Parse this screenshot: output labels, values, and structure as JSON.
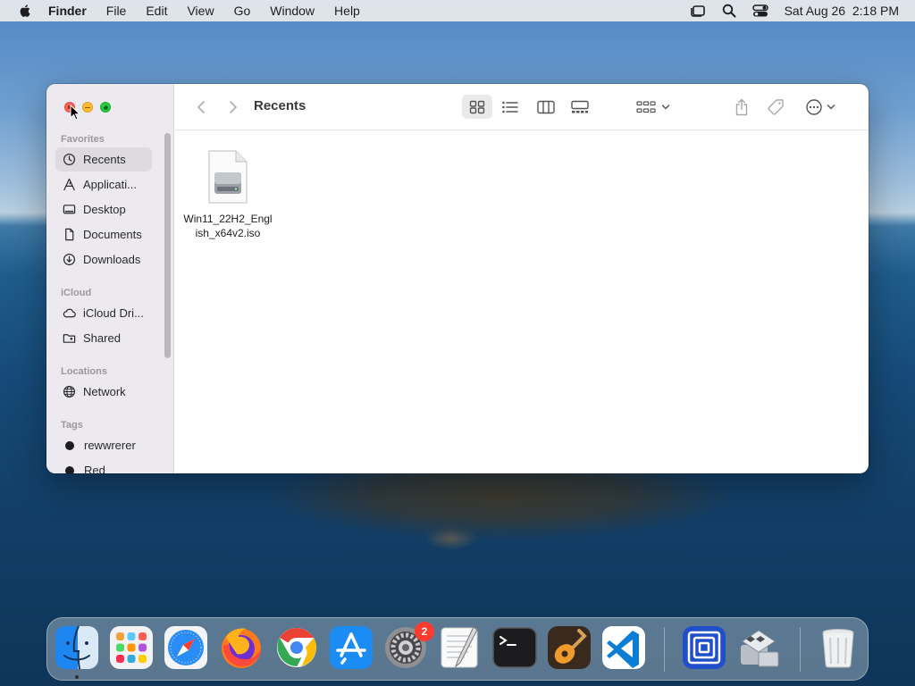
{
  "menubar": {
    "app_name": "Finder",
    "menus": [
      "File",
      "Edit",
      "View",
      "Go",
      "Window",
      "Help"
    ],
    "datetime": "Sat Aug 26  2:18 PM"
  },
  "window": {
    "title": "Recents",
    "sidebar": {
      "favorites_header": "Favorites",
      "favorites": [
        {
          "label": "Recents",
          "icon": "clock-icon",
          "selected": true
        },
        {
          "label": "Applicati...",
          "icon": "applications-icon"
        },
        {
          "label": "Desktop",
          "icon": "desktop-icon"
        },
        {
          "label": "Documents",
          "icon": "document-icon"
        },
        {
          "label": "Downloads",
          "icon": "download-icon"
        }
      ],
      "icloud_header": "iCloud",
      "icloud": [
        {
          "label": "iCloud Dri...",
          "icon": "cloud-icon"
        },
        {
          "label": "Shared",
          "icon": "shared-folder-icon"
        }
      ],
      "locations_header": "Locations",
      "locations": [
        {
          "label": "Network",
          "icon": "globe-icon"
        }
      ],
      "tags_header": "Tags",
      "tags": [
        {
          "label": "rewwrerer",
          "color": "#1d1d1f"
        },
        {
          "label": "Red",
          "color": "#1d1d1f"
        }
      ]
    },
    "files": [
      {
        "name_line1": "Win11_22H2_Engl",
        "name_line2": "ish_x64v2.iso",
        "icon": "disk-image-icon"
      }
    ]
  },
  "dock": {
    "apps": [
      "Finder",
      "Launchpad",
      "Safari",
      "Firefox",
      "Chrome",
      "App Store",
      "System Settings",
      "TextEdit",
      "Terminal",
      "GarageBand",
      "Visual Studio Code",
      "Parallels",
      "Boot Camp Assistant",
      "Trash"
    ],
    "settings_badge": "2"
  },
  "colors": {
    "close": "#fe5f57",
    "minimize": "#febc2e",
    "maximize": "#28c840",
    "badge": "#ff3b30"
  }
}
